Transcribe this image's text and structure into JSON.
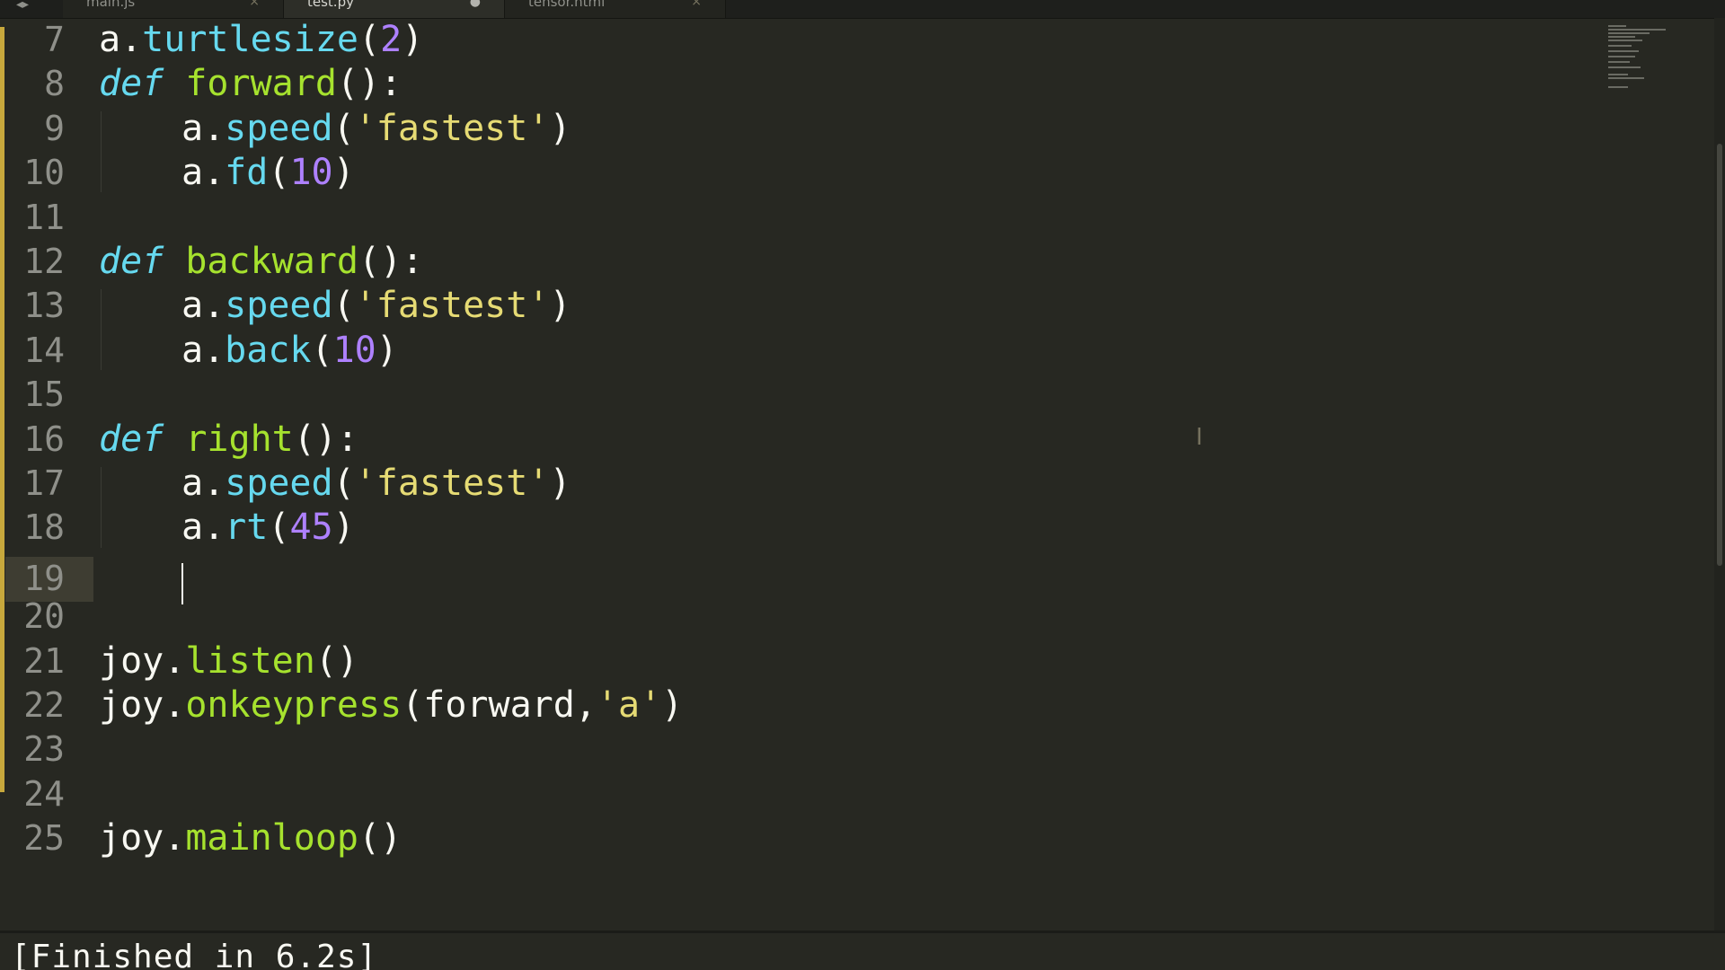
{
  "tabs": [
    {
      "label": "main.js",
      "close": "×"
    },
    {
      "label": "test.py",
      "close": "●"
    },
    {
      "label": "tensor.html",
      "close": "×"
    }
  ],
  "tab_nav": "◂▸",
  "line_numbers": [
    "7",
    "8",
    "9",
    "10",
    "11",
    "12",
    "13",
    "14",
    "15",
    "16",
    "17",
    "18",
    "19",
    "20",
    "21",
    "22",
    "23",
    "24",
    "25"
  ],
  "code": {
    "l7": {
      "a": "a.",
      "b": "turtlesize",
      "c": "(",
      "d": "2",
      "e": ")"
    },
    "l8": {
      "kw": "def",
      "fn": "forward",
      "p": "():"
    },
    "l9": {
      "a": "a.",
      "b": "speed",
      "c": "(",
      "d": "'fastest'",
      "e": ")"
    },
    "l10": {
      "a": "a.",
      "b": "fd",
      "c": "(",
      "d": "10",
      "e": ")"
    },
    "l12": {
      "kw": "def",
      "fn": "backward",
      "p": "():"
    },
    "l13": {
      "a": "a.",
      "b": "speed",
      "c": "(",
      "d": "'fastest'",
      "e": ")"
    },
    "l14": {
      "a": "a.",
      "b": "back",
      "c": "(",
      "d": "10",
      "e": ")"
    },
    "l16": {
      "kw": "def",
      "fn": "right",
      "p": "():"
    },
    "l17": {
      "a": "a.",
      "b": "speed",
      "c": "(",
      "d": "'fastest'",
      "e": ")"
    },
    "l18": {
      "a": "a.",
      "b": "rt",
      "c": "(",
      "d": "45",
      "e": ")"
    },
    "l21": {
      "a": "joy.",
      "b": "listen",
      "c": "()"
    },
    "l22": {
      "a": "joy.",
      "b": "onkeypress",
      "c": "(forward,",
      "d": "'a'",
      "e": ")"
    },
    "l25": {
      "a": "joy.",
      "b": "mainloop",
      "c": "()"
    }
  },
  "output": "[Finished in 6.2s]",
  "colors": {
    "background": "#272822",
    "keyword": "#66d9ef",
    "function_name": "#a6e22e",
    "number": "#ae81ff",
    "string": "#e6db74",
    "text": "#f8f8f2",
    "line_number": "#8f908a",
    "modified_marker": "#c7a83c"
  },
  "icons": {
    "ibeam": "text-cursor-icon"
  },
  "ibeam_glyph": "I"
}
